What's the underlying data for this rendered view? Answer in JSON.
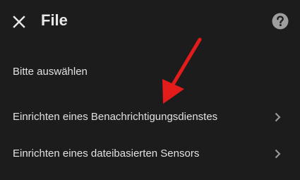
{
  "dialog": {
    "title": "File",
    "close_icon": "close-icon",
    "help_icon": "help-circle-icon"
  },
  "section": {
    "label": "Bitte auswählen"
  },
  "items": [
    {
      "label": "Einrichten eines Benachrichtigungsdienstes",
      "icon": "chevron-right-icon"
    },
    {
      "label": "Einrichten eines dateibasierten Sensors",
      "icon": "chevron-right-icon"
    }
  ],
  "annotation": {
    "type": "arrow",
    "color": "#e31b1b"
  },
  "colors": {
    "background": "#1c1c1c",
    "text": "#e1e1e1",
    "icon": "#9e9e9e"
  }
}
